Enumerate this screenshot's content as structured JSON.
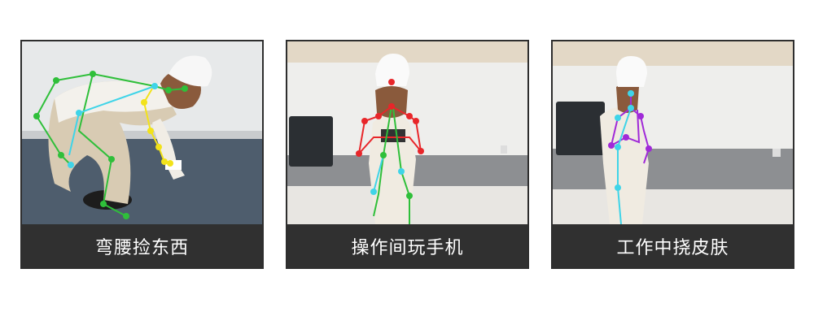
{
  "panels": [
    {
      "caption": "弯腰捡东西",
      "pose_color": "green/yellow/cyan skeleton"
    },
    {
      "caption": "操作间玩手机",
      "pose_color": "red/green/cyan skeleton"
    },
    {
      "caption": "工作中挠皮肤",
      "pose_color": "purple/cyan skeleton"
    }
  ],
  "colors": {
    "caption_bg": "#303030",
    "caption_text": "#ffffff",
    "keypoint_green": "#2fbf3a",
    "keypoint_yellow": "#f2e21a",
    "keypoint_cyan": "#3fd4e8",
    "keypoint_red": "#e8262a",
    "keypoint_purple": "#a02ad8"
  }
}
